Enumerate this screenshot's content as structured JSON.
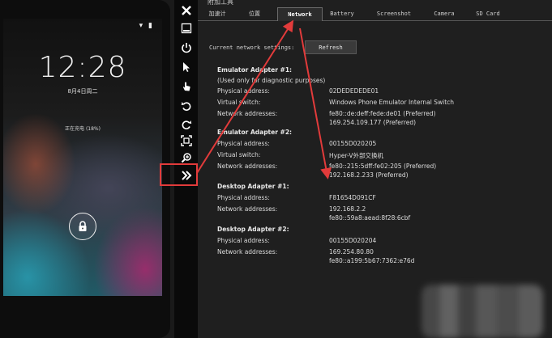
{
  "phone": {
    "status_icons": "▾ ▮",
    "clock": "12:28",
    "date": "8月4日周二",
    "charging": "正在充电 (18%)"
  },
  "toolbar": {
    "icons": [
      "close-icon",
      "minimize-icon",
      "power-icon",
      "pointer-icon",
      "touch-icon",
      "rotate-left-icon",
      "rotate-right-icon",
      "fit-screen-icon",
      "zoom-icon",
      "additional-tools-icon"
    ]
  },
  "panel": {
    "title": "附加工具",
    "tabs": [
      {
        "label": "加速计"
      },
      {
        "label": "位置"
      },
      {
        "label": "Network"
      },
      {
        "label": "Battery"
      },
      {
        "label": "Screenshot"
      },
      {
        "label": "Camera"
      },
      {
        "label": "SD Card"
      }
    ],
    "current_settings_label": "Current network settings:",
    "refresh_label": "Refresh",
    "adapters": [
      {
        "title": "Emulator Adapter #1:",
        "note": "(Used only for diagnostic purposes)",
        "rows": [
          {
            "label": "Physical address:",
            "value": "02DEDEDEDE01",
            "value2": ""
          },
          {
            "label": "Virtual switch:",
            "value": "Windows Phone Emulator Internal Switch",
            "value2": ""
          },
          {
            "label": "Network addresses:",
            "value": "fe80::de:deff:fede:de01 (Preferred)",
            "value2": "169.254.109.177 (Preferred)"
          }
        ]
      },
      {
        "title": "Emulator Adapter #2:",
        "note": "",
        "rows": [
          {
            "label": "Physical address:",
            "value": "00155D020205",
            "value2": ""
          },
          {
            "label": "Virtual switch:",
            "value": "Hyper-V外部交换机",
            "value2": ""
          },
          {
            "label": "Network addresses:",
            "value": "fe80::215:5dff:fe02:205 (Preferred)",
            "value2": "192.168.2.233 (Preferred)"
          }
        ]
      },
      {
        "title": "Desktop Adapter #1:",
        "note": "",
        "rows": [
          {
            "label": "Physical address:",
            "value": "F81654D091CF",
            "value2": ""
          },
          {
            "label": "Network addresses:",
            "value": "192.168.2.2",
            "value2": "fe80::59a8:aead:8f28:6cbf"
          }
        ]
      },
      {
        "title": "Desktop Adapter #2:",
        "note": "",
        "rows": [
          {
            "label": "Physical address:",
            "value": "00155D020204",
            "value2": ""
          },
          {
            "label": "Network addresses:",
            "value": "169.254.80.80",
            "value2": "fe80::a199:5b67:7362:e76d"
          }
        ]
      }
    ]
  },
  "colors": {
    "annotation": "#e23b3b",
    "panel_bg": "#1f1f1f",
    "toolbar_bg": "#0a0a0a"
  }
}
